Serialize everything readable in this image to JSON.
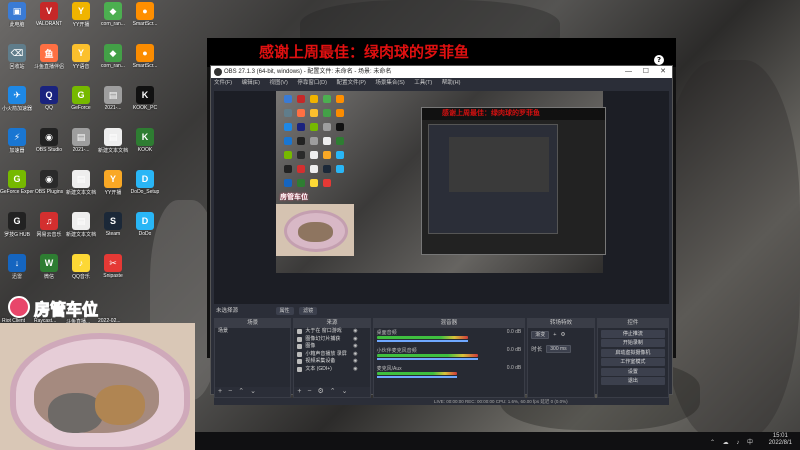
{
  "desktop": {
    "icons": [
      {
        "label": "此电脑",
        "color": "#3a7bd5",
        "glyph": "▣"
      },
      {
        "label": "VALORANT",
        "color": "#c62828",
        "glyph": "V"
      },
      {
        "label": "YY开播",
        "color": "#f0b400",
        "glyph": "Y"
      },
      {
        "label": "corn_ran...",
        "color": "#4caf50",
        "glyph": "◆"
      },
      {
        "label": "SmartScr...",
        "color": "#ff8f00",
        "glyph": "●"
      },
      {
        "label": "回收站",
        "color": "#607d8b",
        "glyph": "⌫"
      },
      {
        "label": "斗鱼直播伴侣",
        "color": "#ff7043",
        "glyph": "鱼"
      },
      {
        "label": "YY语音",
        "color": "#fbc02d",
        "glyph": "Y"
      },
      {
        "label": "corn_ran...",
        "color": "#43a047",
        "glyph": "◆"
      },
      {
        "label": "SmartScr...",
        "color": "#fb8c00",
        "glyph": "●"
      },
      {
        "label": "小火箭加速器",
        "color": "#1e88e5",
        "glyph": "✈"
      },
      {
        "label": "QQ",
        "color": "#1a237e",
        "glyph": "Q"
      },
      {
        "label": "GeForce",
        "color": "#76b900",
        "glyph": "G"
      },
      {
        "label": "2021-...",
        "color": "#9e9e9e",
        "glyph": "▤"
      },
      {
        "label": "KOOK_PC",
        "color": "#111111",
        "glyph": "K"
      },
      {
        "label": "加速器",
        "color": "#1976d2",
        "glyph": "⚡"
      },
      {
        "label": "OBS Studio",
        "color": "#222222",
        "glyph": "◉"
      },
      {
        "label": "2021-...",
        "color": "#9e9e9e",
        "glyph": "▤"
      },
      {
        "label": "新建文本文档",
        "color": "#eeeeee",
        "glyph": "▤"
      },
      {
        "label": "KOOK",
        "color": "#2e7d32",
        "glyph": "K"
      },
      {
        "label": "GeForce Experience",
        "color": "#76b900",
        "glyph": "G"
      },
      {
        "label": "OBS Plugins",
        "color": "#2a2a2a",
        "glyph": "◉"
      },
      {
        "label": "新建文本文档",
        "color": "#eeeeee",
        "glyph": "▤"
      },
      {
        "label": "YY开播",
        "color": "#f9a825",
        "glyph": "Y"
      },
      {
        "label": "DoDo_Setup",
        "color": "#29b6f6",
        "glyph": "D"
      },
      {
        "label": "罗技G HUB",
        "color": "#222",
        "glyph": "G"
      },
      {
        "label": "网易云音乐",
        "color": "#d32f2f",
        "glyph": "♫"
      },
      {
        "label": "新建文本文档",
        "color": "#eeeeee",
        "glyph": "▤"
      },
      {
        "label": "Steam",
        "color": "#1b2838",
        "glyph": "S"
      },
      {
        "label": "DoDo",
        "color": "#29b6f6",
        "glyph": "D"
      },
      {
        "label": "迅雷",
        "color": "#1565c0",
        "glyph": "↓"
      },
      {
        "label": "微信",
        "color": "#2e7d32",
        "glyph": "W"
      },
      {
        "label": "QQ音乐",
        "color": "#fdd835",
        "glyph": "♪"
      },
      {
        "label": "Snipaste",
        "color": "#e53935",
        "glyph": "✂"
      }
    ],
    "sticker_text": "房管车位",
    "bottom_labels": [
      "Riot Client",
      "Raycast...",
      "斗鱼直播...",
      "2022-02..."
    ]
  },
  "stream_banner": "感谢上周最佳：绿肉球的罗菲鱼",
  "obs": {
    "title": "OBS 27.1.3 (64-bit, windows) - 配置文件: 未命名 - 场景: 未命名",
    "window_controls": [
      "—",
      "☐",
      "✕"
    ],
    "menu": [
      "文件(F)",
      "编辑(E)",
      "视图(V)",
      "停靠窗口(D)",
      "配置文件(P)",
      "场景集合(S)",
      "工具(T)",
      "帮助(H)"
    ],
    "context_bar": {
      "label": "未选择源",
      "buttons": [
        "属性",
        "滤镜"
      ]
    },
    "panels": {
      "scenes": {
        "title": "场景",
        "items": [
          "场景"
        ]
      },
      "sources": {
        "title": "来源",
        "items": [
          "大于在 窗口游戏",
          "图像幻灯片捕获",
          "图像",
          "小箱声音播放 录屏",
          "视频采集设备",
          "文本 (GDI+)"
        ]
      },
      "mixer": {
        "title": "混音器",
        "tracks": [
          {
            "name": "桌面音频",
            "db": "0.0 dB",
            "level": 0.7
          },
          {
            "name": "小伙伴麦克风音频",
            "db": "0.0 dB",
            "level": 0.78
          },
          {
            "name": "麦克风/Aux",
            "db": "0.0 dB",
            "level": 0.62
          }
        ]
      },
      "transitions": {
        "title": "转场特效",
        "type": "渐变",
        "duration_label": "时长",
        "duration": "300 ms"
      },
      "controls": {
        "title": "控件",
        "buttons": [
          "停止推流",
          "开始录制",
          "启动虚拟摄像机",
          "工作室模式",
          "设置",
          "退出"
        ]
      }
    },
    "status": "LIVE: 00:00:00   REC: 00:00:00   CPU: 1.6%, 60.00 fps   延迟 0 (0.0%)"
  },
  "taskbar": {
    "time": "15:01",
    "date": "2022/8/1",
    "tray": "⌃ ☁ ♪ 中"
  }
}
